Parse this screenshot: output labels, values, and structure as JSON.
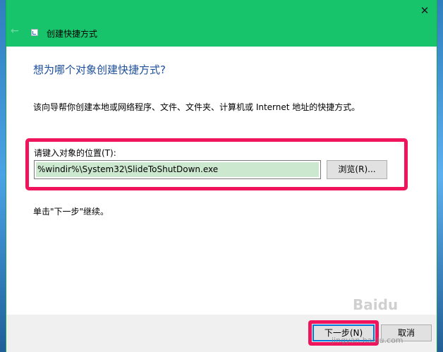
{
  "window": {
    "title": "创建快捷方式",
    "close_glyph": "✕",
    "back_glyph": "←",
    "title_color": "#17c46c"
  },
  "main": {
    "heading": "想为哪个对象创建快捷方式?",
    "description": "该向导帮你创建本地或网络程序、文件、文件夹、计算机或 Internet 地址的快捷方式。",
    "field_label": "请键入对象的位置(T):",
    "location_value": "%windir%\\System32\\SlideToShutDown.exe",
    "browse_label": "浏览(R)...",
    "hint": "单击\"下一步\"继续。"
  },
  "footer": {
    "next_label": "下一步(N)",
    "cancel_label": "取消"
  },
  "watermark": {
    "brand": "Baidu",
    "sub": "jingyan.baidu.com"
  },
  "colors": {
    "highlight": "#f0145c",
    "heading": "#1c4e9a",
    "selection": "#cce8cf"
  }
}
